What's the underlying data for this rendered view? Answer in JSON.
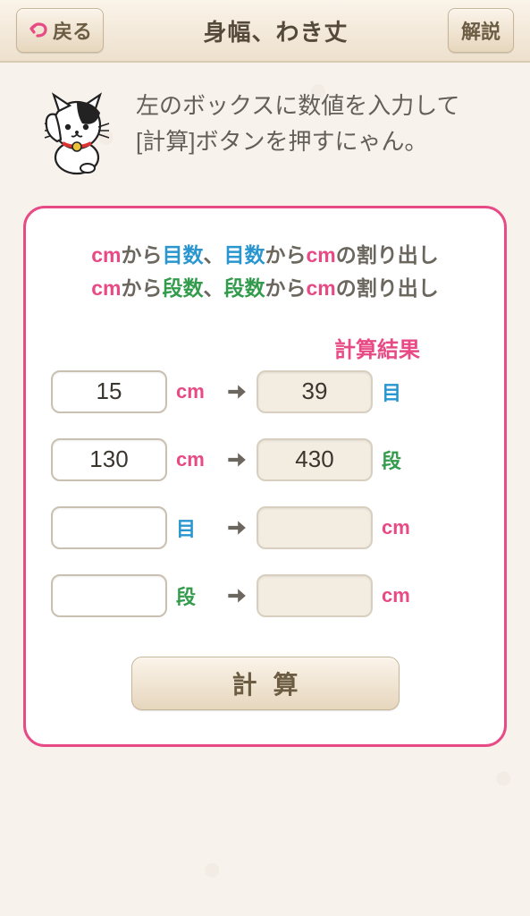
{
  "header": {
    "back_label": "戻る",
    "title": "身幅、わき丈",
    "help_label": "解説"
  },
  "intro": {
    "line1": "左のボックスに数値を入力して",
    "line2": "[計算]ボタンを押すにゃん。"
  },
  "heading": {
    "cm1": "cm",
    "t1": "から",
    "me1": "目数",
    "t2": "、",
    "me2": "目数",
    "t3": "から",
    "cm2": "cm",
    "t4": "の割り出し",
    "cm3": "cm",
    "t5": "から",
    "dan1": "段数",
    "t6": "、",
    "dan2": "段数",
    "t7": "から",
    "cm4": "cm",
    "t8": "の割り出し"
  },
  "result_label": "計算結果",
  "rows": [
    {
      "input": "15",
      "in_unit": "cm",
      "in_class": "cm",
      "out": "39",
      "out_unit": "目",
      "out_class": "me"
    },
    {
      "input": "130",
      "in_unit": "cm",
      "in_class": "cm",
      "out": "430",
      "out_unit": "段",
      "out_class": "dan"
    },
    {
      "input": "",
      "in_unit": "目",
      "in_class": "me",
      "out": "",
      "out_unit": "cm",
      "out_class": "cm"
    },
    {
      "input": "",
      "in_unit": "段",
      "in_class": "dan",
      "out": "",
      "out_unit": "cm",
      "out_class": "cm"
    }
  ],
  "calc_label": "計算"
}
